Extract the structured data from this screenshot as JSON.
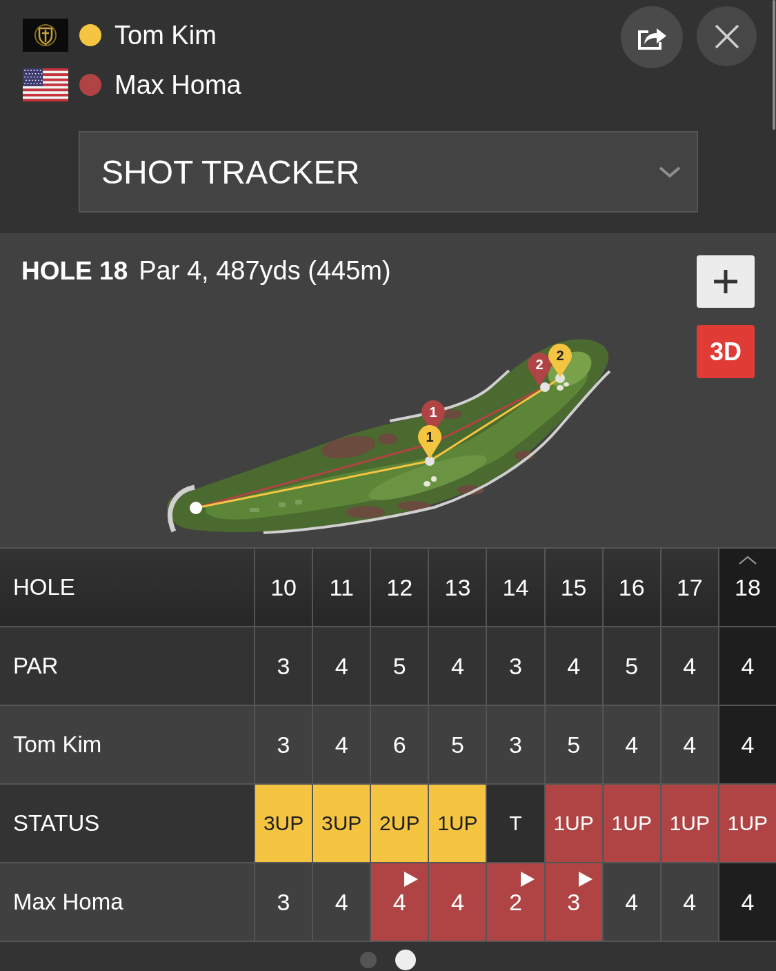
{
  "players": [
    {
      "name": "Tom Kim",
      "kind": "logo",
      "color": "#f5c542"
    },
    {
      "name": "Max Homa",
      "kind": "flag",
      "color": "#b04444"
    }
  ],
  "view_select": {
    "value": "SHOT TRACKER"
  },
  "hole_info": {
    "title": "HOLE 18",
    "details": "Par 4, 487yds (445m)"
  },
  "map_controls": {
    "view_toggle": "3D"
  },
  "course_map": {
    "tracks": [
      {
        "color": "#b04444",
        "markers": [
          "1",
          "2"
        ]
      },
      {
        "color": "#f5c542",
        "markers": [
          "1",
          "2"
        ]
      }
    ]
  },
  "scorecard": {
    "rows": [
      {
        "kind": "hole",
        "label": "HOLE",
        "cells": [
          {
            "text": "10",
            "selected": false
          },
          {
            "text": "11",
            "selected": false
          },
          {
            "text": "12",
            "selected": false
          },
          {
            "text": "13",
            "selected": false
          },
          {
            "text": "14",
            "selected": false
          },
          {
            "text": "15",
            "selected": false
          },
          {
            "text": "16",
            "selected": false
          },
          {
            "text": "17",
            "selected": false
          },
          {
            "text": "18",
            "selected": true
          }
        ]
      },
      {
        "kind": "par",
        "label": "PAR",
        "cells": [
          {
            "text": "3"
          },
          {
            "text": "4"
          },
          {
            "text": "5"
          },
          {
            "text": "4"
          },
          {
            "text": "3"
          },
          {
            "text": "4"
          },
          {
            "text": "5"
          },
          {
            "text": "4"
          },
          {
            "text": "4"
          }
        ]
      },
      {
        "kind": "player",
        "label": "Tom Kim",
        "cells": [
          {
            "text": "3",
            "won": false,
            "play_marker": false
          },
          {
            "text": "4",
            "won": false,
            "play_marker": false
          },
          {
            "text": "6",
            "won": false,
            "play_marker": false
          },
          {
            "text": "5",
            "won": false,
            "play_marker": false
          },
          {
            "text": "3",
            "won": false,
            "play_marker": false
          },
          {
            "text": "5",
            "won": false,
            "play_marker": false
          },
          {
            "text": "4",
            "won": false,
            "play_marker": false
          },
          {
            "text": "4",
            "won": false,
            "play_marker": false
          },
          {
            "text": "4",
            "won": false,
            "play_marker": false
          }
        ]
      },
      {
        "kind": "status",
        "label": "STATUS",
        "cells": [
          {
            "text": "3UP",
            "color": "#f5c542"
          },
          {
            "text": "3UP",
            "color": "#f5c542"
          },
          {
            "text": "2UP",
            "color": "#f5c542"
          },
          {
            "text": "1UP",
            "color": "#f5c542"
          },
          {
            "text": "T",
            "color": "#2e2e2e"
          },
          {
            "text": "1UP",
            "color": "#b04444"
          },
          {
            "text": "1UP",
            "color": "#b04444"
          },
          {
            "text": "1UP",
            "color": "#b04444"
          },
          {
            "text": "1UP",
            "color": "#b04444"
          }
        ]
      },
      {
        "kind": "player",
        "label": "Max Homa",
        "cells": [
          {
            "text": "3",
            "won": false,
            "play_marker": false
          },
          {
            "text": "4",
            "won": false,
            "play_marker": false
          },
          {
            "text": "4",
            "won": true,
            "play_marker": true
          },
          {
            "text": "4",
            "won": true,
            "play_marker": false
          },
          {
            "text": "2",
            "won": true,
            "play_marker": true
          },
          {
            "text": "3",
            "won": true,
            "play_marker": true
          },
          {
            "text": "4",
            "won": false,
            "play_marker": false
          },
          {
            "text": "4",
            "won": false,
            "play_marker": false
          },
          {
            "text": "4",
            "won": false,
            "play_marker": false
          }
        ]
      }
    ]
  },
  "pager": [
    {
      "selected": false
    },
    {
      "selected": true
    }
  ]
}
